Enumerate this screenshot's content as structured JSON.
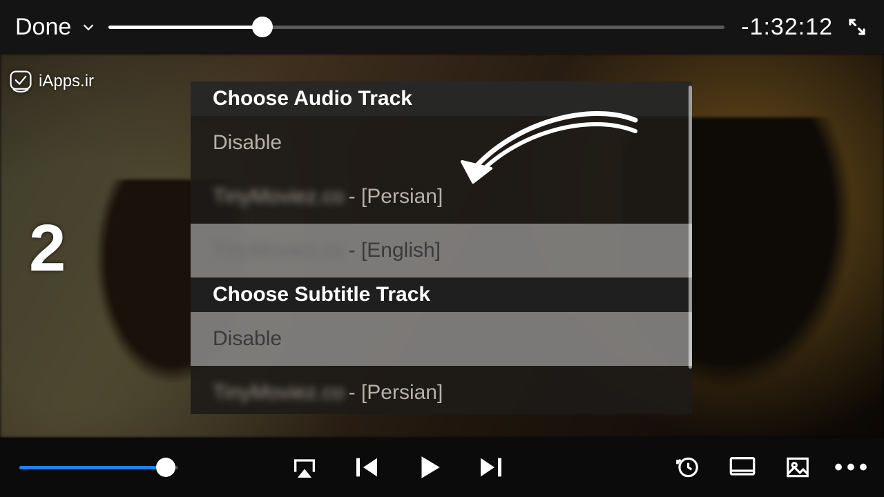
{
  "topbar": {
    "done_label": "Done",
    "remaining_time": "-1:32:12",
    "progress_pct": 25
  },
  "watermark": {
    "text": "iApps.ir"
  },
  "annotation": {
    "step_number": "2"
  },
  "menu": {
    "audio_header": "Choose Audio Track",
    "subtitle_header": "Choose Subtitle Track",
    "disable_label": "Disable",
    "track_prefix": "TinyMoviez.co",
    "audio_tracks": [
      {
        "lang_suffix": " - [Persian]",
        "selected": false
      },
      {
        "lang_suffix": " - [English]",
        "selected": true
      }
    ],
    "subtitle_tracks": [
      {
        "lang_suffix": " - [Persian]",
        "selected": false
      }
    ],
    "subtitle_disable_selected": true
  },
  "bottom": {
    "volume_pct": 92
  }
}
